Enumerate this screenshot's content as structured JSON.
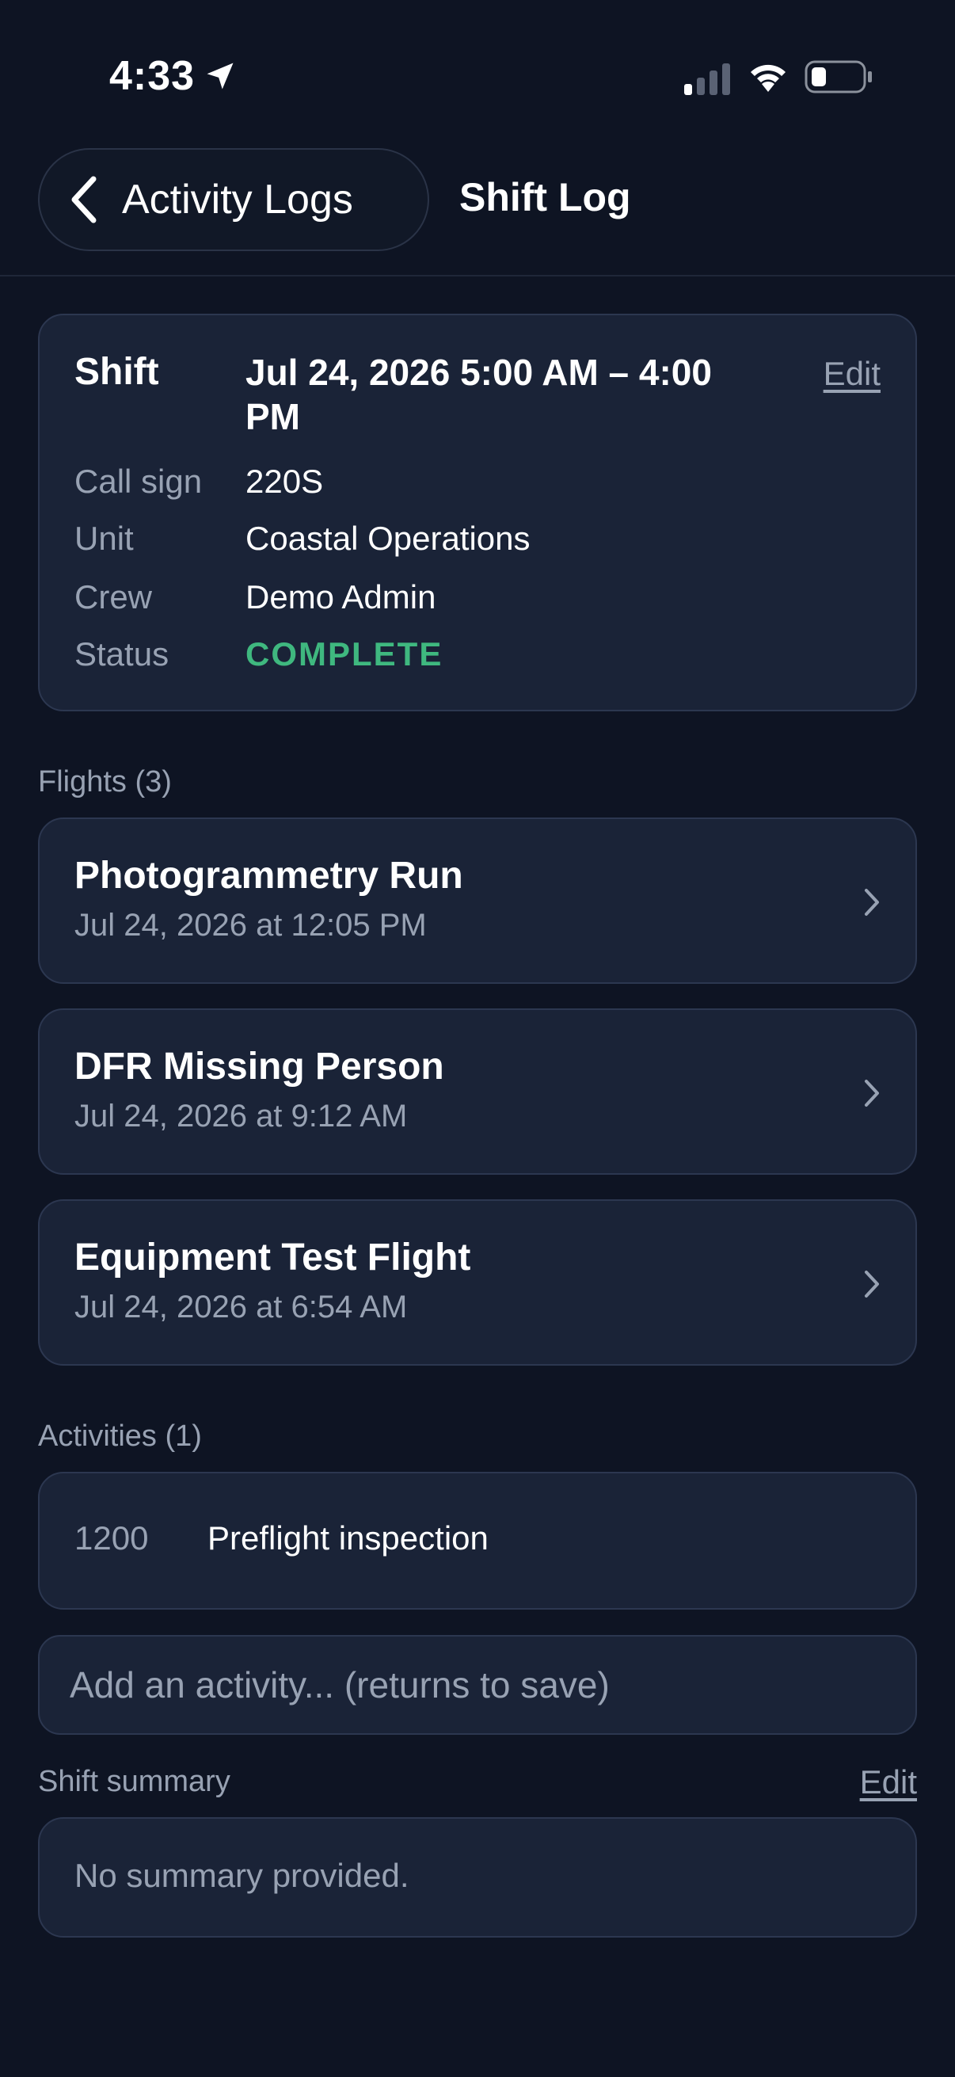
{
  "status_bar": {
    "time": "4:33"
  },
  "header": {
    "back_label": "Activity Logs",
    "title": "Shift Log"
  },
  "shift": {
    "label": "Shift",
    "value": "Jul 24, 2026  5:00 AM – 4:00 PM",
    "edit": "Edit",
    "fields": [
      {
        "label": "Call sign",
        "value": "220S"
      },
      {
        "label": "Unit",
        "value": "Coastal Operations"
      },
      {
        "label": "Crew",
        "value": "Demo Admin"
      },
      {
        "label": "Status",
        "value": "COMPLETE"
      }
    ],
    "status_color": "#3fb87f"
  },
  "flights": {
    "label": "Flights (3)",
    "items": [
      {
        "title": "Photogrammetry Run",
        "subtitle": "Jul 24, 2026 at 12:05 PM"
      },
      {
        "title": "DFR Missing Person",
        "subtitle": "Jul 24, 2026 at 9:12 AM"
      },
      {
        "title": "Equipment Test Flight",
        "subtitle": "Jul 24, 2026 at 6:54 AM"
      }
    ]
  },
  "activities": {
    "label": "Activities (1)",
    "items": [
      {
        "time": "1200",
        "text": "Preflight inspection"
      }
    ],
    "add_placeholder": "Add an activity... (returns to save)"
  },
  "summary": {
    "label": "Shift summary",
    "edit": "Edit",
    "text": "No summary provided."
  }
}
